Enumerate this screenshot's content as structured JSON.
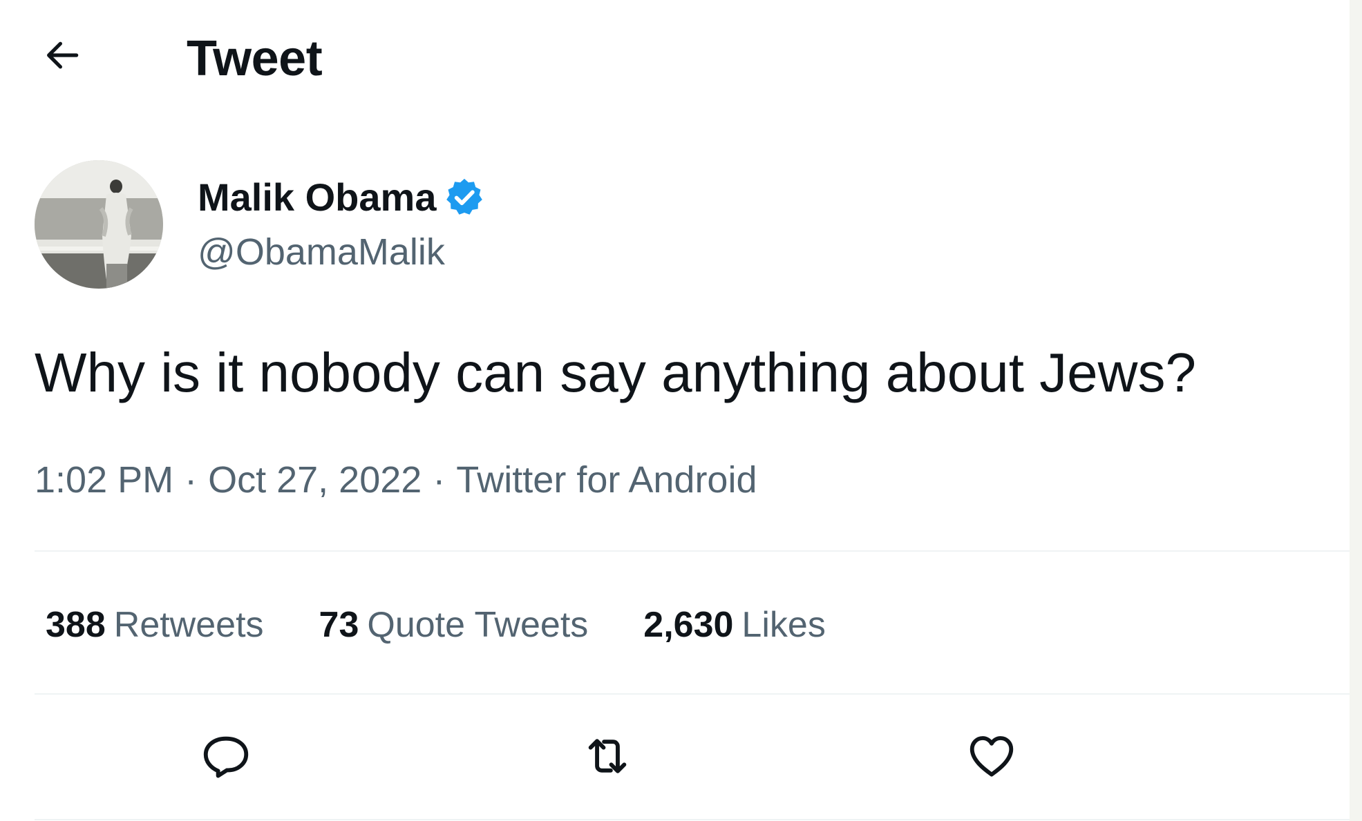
{
  "header": {
    "back_icon": "arrow-left-icon",
    "title": "Tweet"
  },
  "author": {
    "name": "Malik Obama",
    "handle": "@ObamaMalik",
    "verified": true,
    "verified_icon": "verified-badge-icon",
    "verified_color": "#1d9bf0"
  },
  "tweet": {
    "text": "Why is it nobody can say anything about Jews?",
    "time": "1:02 PM",
    "date": "Oct 27, 2022",
    "source": "Twitter for Android",
    "separator": "·"
  },
  "stats": [
    {
      "count": "388",
      "label": "Retweets"
    },
    {
      "count": "73",
      "label": "Quote Tweets"
    },
    {
      "count": "2,630",
      "label": "Likes"
    }
  ],
  "actions": {
    "reply_icon": "reply-icon",
    "retweet_icon": "retweet-icon",
    "like_icon": "heart-icon"
  },
  "colors": {
    "text_primary": "#0f1419",
    "text_secondary": "#536471",
    "divider": "#eff3f4",
    "accent": "#1d9bf0"
  }
}
